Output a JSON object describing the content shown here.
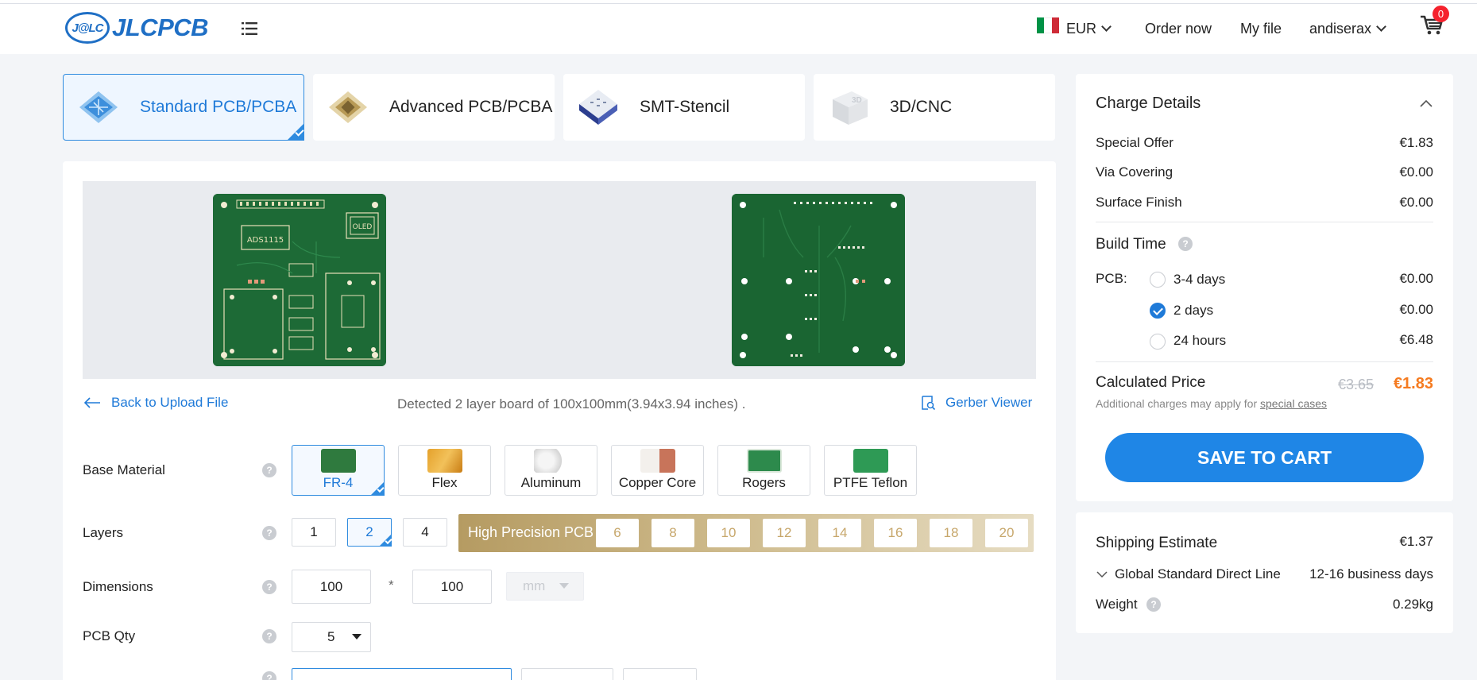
{
  "header": {
    "logo_badge": "J@LC",
    "logo_text": "JLCPCB",
    "currency": "EUR",
    "order_now": "Order now",
    "my_file": "My file",
    "user": "andiserax",
    "cart_count": "0",
    "flag_colors": [
      "#009246",
      "#ffffff",
      "#ce2b37"
    ]
  },
  "tabs": [
    {
      "label": "Standard PCB/PCBA",
      "icon": "standard-pcb-icon",
      "active": true
    },
    {
      "label": "Advanced PCB/PCBA",
      "icon": "advanced-pcb-icon",
      "active": false
    },
    {
      "label": "SMT-Stencil",
      "icon": "smt-stencil-icon",
      "active": false
    },
    {
      "label": "3D/CNC",
      "icon": "3d-cnc-icon",
      "active": false
    }
  ],
  "preview": {
    "front_labels": [
      "OLED",
      "ADS1115"
    ],
    "back_link": "Back to Upload File",
    "detected": "Detected 2 layer board of 100x100mm(3.94x3.94 inches) .",
    "gerber_viewer": "Gerber Viewer"
  },
  "form": {
    "base_material": {
      "label": "Base Material",
      "options": [
        "FR-4",
        "Flex",
        "Aluminum",
        "Copper Core",
        "Rogers",
        "PTFE Teflon"
      ],
      "selected": "FR-4"
    },
    "layers": {
      "label": "Layers",
      "options": [
        "1",
        "2",
        "4"
      ],
      "selected": "2",
      "high_precision_label": "High Precision PCB",
      "high_precision_options": [
        "6",
        "8",
        "10",
        "12",
        "14",
        "16",
        "18",
        "20"
      ]
    },
    "dimensions": {
      "label": "Dimensions",
      "width": "100",
      "separator": "*",
      "height": "100",
      "unit": "mm"
    },
    "pcb_qty": {
      "label": "PCB Qty",
      "value": "5"
    },
    "help_mark": "?"
  },
  "charge": {
    "title": "Charge Details",
    "rows": [
      {
        "label": "Special Offer",
        "value": "€1.83"
      },
      {
        "label": "Via Covering",
        "value": "€0.00"
      },
      {
        "label": "Surface Finish",
        "value": "€0.00"
      }
    ],
    "build_time_title": "Build Time",
    "pcb_label": "PCB:",
    "build_options": [
      {
        "label": "3-4 days",
        "price": "€0.00",
        "selected": false
      },
      {
        "label": "2 days",
        "price": "€0.00",
        "selected": true
      },
      {
        "label": "24 hours",
        "price": "€6.48",
        "selected": false
      }
    ],
    "calculated_label": "Calculated Price",
    "old_price": "€3.65",
    "new_price": "€1.83",
    "note_prefix": "Additional charges may apply for",
    "note_link": "special cases",
    "save_button": "SAVE TO CART"
  },
  "shipping": {
    "title": "Shipping Estimate",
    "price": "€1.37",
    "method": "Global Standard Direct Line",
    "days": "12-16 business days",
    "weight_label": "Weight",
    "weight": "0.29kg"
  },
  "colors": {
    "accent": "#1f86e6",
    "price_orange": "#f57b20",
    "pcb_green": "#1c6634",
    "gold": "#c7a76b"
  }
}
